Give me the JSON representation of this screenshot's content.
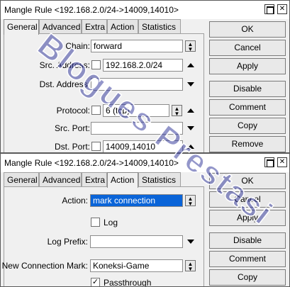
{
  "win1": {
    "title": "Mangle Rule <192.168.2.0/24->14009,14010>",
    "tabs": [
      "General",
      "Advanced",
      "Extra",
      "Action",
      "Statistics"
    ],
    "fields": {
      "chain_label": "Chain:",
      "chain_value": "forward",
      "src_address_label": "Src. Address:",
      "src_address_value": "192.168.2.0/24",
      "dst_address_label": "Dst. Address:",
      "protocol_label": "Protocol:",
      "protocol_value": "6 (tcp)",
      "src_port_label": "Src. Port:",
      "dst_port_label": "Dst. Port:",
      "dst_port_value": "14009,14010"
    },
    "buttons": [
      "OK",
      "Cancel",
      "Apply",
      "Disable",
      "Comment",
      "Copy",
      "Remove"
    ]
  },
  "win2": {
    "title": "Mangle Rule <192.168.2.0/24->14009,14010>",
    "tabs": [
      "General",
      "Advanced",
      "Extra",
      "Action",
      "Statistics"
    ],
    "fields": {
      "action_label": "Action:",
      "action_value": "mark connection",
      "log_label": "Log",
      "log_prefix_label": "Log Prefix:",
      "new_conn_mark_label": "New Connection Mark:",
      "new_conn_mark_value": "Koneksi-Game",
      "passthrough_label": "Passthrough"
    },
    "buttons": [
      "OK",
      "Cancel",
      "Apply",
      "Disable",
      "Comment",
      "Copy"
    ]
  },
  "window_controls": {
    "close_glyph": "✕"
  },
  "checkmark": "✓",
  "watermark": "Blogues Prestasi",
  "colors": {
    "selection": "#0a64d8",
    "watermark": "#3a3f9f"
  }
}
